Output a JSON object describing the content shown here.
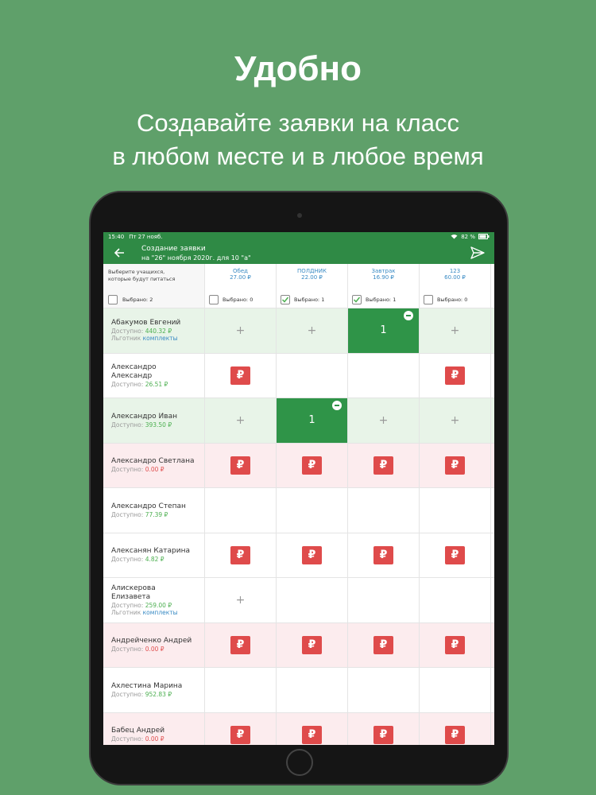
{
  "promo": {
    "title": "Удобно",
    "subtitle_line1": "Создавайте заявки на класс",
    "subtitle_line2": "в любом месте и в любое время"
  },
  "statusbar": {
    "time": "15:40",
    "date": "Пт 27 нояб.",
    "battery": "82 %"
  },
  "appbar": {
    "title": "Создание заявки",
    "subtitle": "на \"26\" ноября 2020г. для 10 \"а\""
  },
  "header": {
    "prompt_line1": "Выберите учащихся,",
    "prompt_line2": "которые будут питаться",
    "selected_label": "Выбрано: 2",
    "meals": [
      {
        "name": "Обед",
        "price": "27.00 ₽",
        "selected": "Выбрано: 0",
        "checked": false
      },
      {
        "name": "ПОЛДНИК",
        "price": "22.00 ₽",
        "selected": "Выбрано: 1",
        "checked": true
      },
      {
        "name": "Завтрак",
        "price": "16.90 ₽",
        "selected": "Выбрано: 1",
        "checked": true
      },
      {
        "name": "123",
        "price": "60.00 ₽",
        "selected": "Выбрано: 0",
        "checked": false
      }
    ]
  },
  "labels": {
    "available": "Доступно: ",
    "benefit": "Льготник ",
    "kits": "комплекты"
  },
  "rows": [
    {
      "name1": "Абакумов Евгений",
      "name2": "",
      "amount": "440.32 ₽",
      "benefit": true,
      "tone": "green",
      "cells": [
        "plus",
        "plus",
        "sel",
        "plus"
      ],
      "sel_value": "1"
    },
    {
      "name1": "Александро",
      "name2": "Александр",
      "amount": "26.51 ₽",
      "benefit": false,
      "tone": "plain",
      "cells": [
        "pay",
        "empty",
        "empty",
        "pay"
      ],
      "sel_value": ""
    },
    {
      "name1": "Александро Иван",
      "name2": "",
      "amount": "393.50 ₽",
      "benefit": false,
      "tone": "green",
      "cells": [
        "plus",
        "sel",
        "plus",
        "plus"
      ],
      "sel_value": "1"
    },
    {
      "name1": "Александро Светлана",
      "name2": "",
      "amount": "0.00 ₽",
      "benefit": false,
      "tone": "pink",
      "cells": [
        "pay",
        "pay",
        "pay",
        "pay"
      ],
      "sel_value": ""
    },
    {
      "name1": "Александро Степан",
      "name2": "",
      "amount": "77.39 ₽",
      "benefit": false,
      "tone": "plain",
      "cells": [
        "empty",
        "empty",
        "empty",
        "empty"
      ],
      "sel_value": ""
    },
    {
      "name1": "Алексанян Катарина",
      "name2": "",
      "amount": "4.82 ₽",
      "benefit": false,
      "tone": "plain",
      "cells": [
        "pay",
        "pay",
        "pay",
        "pay"
      ],
      "sel_value": ""
    },
    {
      "name1": "Алискерова",
      "name2": "Елизавета",
      "amount": "259.00 ₽",
      "benefit": true,
      "tone": "plain",
      "cells": [
        "plus",
        "empty",
        "empty",
        "empty"
      ],
      "sel_value": ""
    },
    {
      "name1": "Андрейченко Андрей",
      "name2": "",
      "amount": "0.00 ₽",
      "benefit": false,
      "tone": "pink",
      "cells": [
        "pay",
        "pay",
        "pay",
        "pay"
      ],
      "sel_value": ""
    },
    {
      "name1": "Ахлестина Марина",
      "name2": "",
      "amount": "952.83 ₽",
      "benefit": false,
      "tone": "plain",
      "cells": [
        "empty",
        "empty",
        "empty",
        "empty"
      ],
      "sel_value": ""
    },
    {
      "name1": "Бабец Андрей",
      "name2": "",
      "amount": "0.00 ₽",
      "benefit": false,
      "tone": "pink",
      "cells": [
        "pay",
        "pay",
        "pay",
        "pay"
      ],
      "sel_value": ""
    }
  ],
  "symbols": {
    "plus": "+",
    "ruble": "₽"
  },
  "colors": {
    "brand_green": "#2f8a45",
    "background": "#5fa06a",
    "pay_red": "#df4b4b",
    "link_blue": "#3a8bc4"
  }
}
